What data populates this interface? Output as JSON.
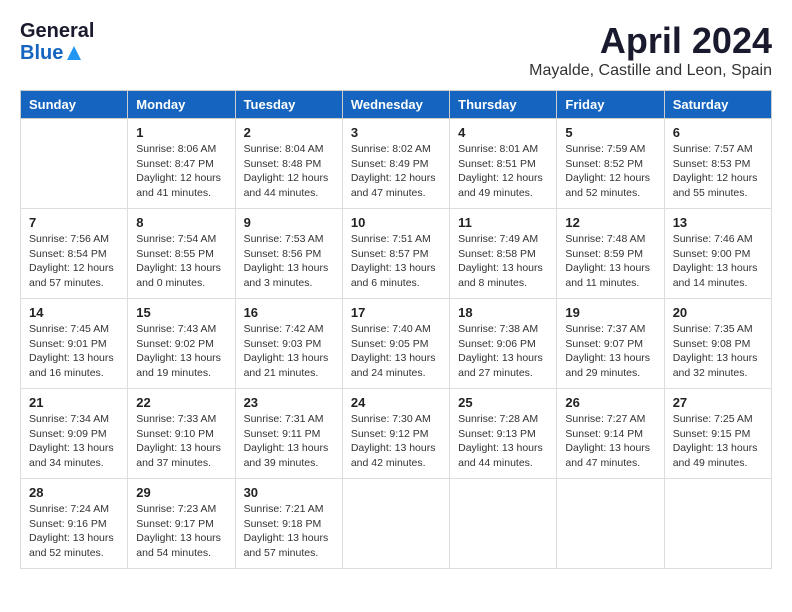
{
  "header": {
    "logo_general": "General",
    "logo_blue": "Blue",
    "month_title": "April 2024",
    "location": "Mayalde, Castille and Leon, Spain"
  },
  "columns": [
    "Sunday",
    "Monday",
    "Tuesday",
    "Wednesday",
    "Thursday",
    "Friday",
    "Saturday"
  ],
  "weeks": [
    [
      {
        "day": "",
        "lines": []
      },
      {
        "day": "1",
        "lines": [
          "Sunrise: 8:06 AM",
          "Sunset: 8:47 PM",
          "Daylight: 12 hours",
          "and 41 minutes."
        ]
      },
      {
        "day": "2",
        "lines": [
          "Sunrise: 8:04 AM",
          "Sunset: 8:48 PM",
          "Daylight: 12 hours",
          "and 44 minutes."
        ]
      },
      {
        "day": "3",
        "lines": [
          "Sunrise: 8:02 AM",
          "Sunset: 8:49 PM",
          "Daylight: 12 hours",
          "and 47 minutes."
        ]
      },
      {
        "day": "4",
        "lines": [
          "Sunrise: 8:01 AM",
          "Sunset: 8:51 PM",
          "Daylight: 12 hours",
          "and 49 minutes."
        ]
      },
      {
        "day": "5",
        "lines": [
          "Sunrise: 7:59 AM",
          "Sunset: 8:52 PM",
          "Daylight: 12 hours",
          "and 52 minutes."
        ]
      },
      {
        "day": "6",
        "lines": [
          "Sunrise: 7:57 AM",
          "Sunset: 8:53 PM",
          "Daylight: 12 hours",
          "and 55 minutes."
        ]
      }
    ],
    [
      {
        "day": "7",
        "lines": [
          "Sunrise: 7:56 AM",
          "Sunset: 8:54 PM",
          "Daylight: 12 hours",
          "and 57 minutes."
        ]
      },
      {
        "day": "8",
        "lines": [
          "Sunrise: 7:54 AM",
          "Sunset: 8:55 PM",
          "Daylight: 13 hours",
          "and 0 minutes."
        ]
      },
      {
        "day": "9",
        "lines": [
          "Sunrise: 7:53 AM",
          "Sunset: 8:56 PM",
          "Daylight: 13 hours",
          "and 3 minutes."
        ]
      },
      {
        "day": "10",
        "lines": [
          "Sunrise: 7:51 AM",
          "Sunset: 8:57 PM",
          "Daylight: 13 hours",
          "and 6 minutes."
        ]
      },
      {
        "day": "11",
        "lines": [
          "Sunrise: 7:49 AM",
          "Sunset: 8:58 PM",
          "Daylight: 13 hours",
          "and 8 minutes."
        ]
      },
      {
        "day": "12",
        "lines": [
          "Sunrise: 7:48 AM",
          "Sunset: 8:59 PM",
          "Daylight: 13 hours",
          "and 11 minutes."
        ]
      },
      {
        "day": "13",
        "lines": [
          "Sunrise: 7:46 AM",
          "Sunset: 9:00 PM",
          "Daylight: 13 hours",
          "and 14 minutes."
        ]
      }
    ],
    [
      {
        "day": "14",
        "lines": [
          "Sunrise: 7:45 AM",
          "Sunset: 9:01 PM",
          "Daylight: 13 hours",
          "and 16 minutes."
        ]
      },
      {
        "day": "15",
        "lines": [
          "Sunrise: 7:43 AM",
          "Sunset: 9:02 PM",
          "Daylight: 13 hours",
          "and 19 minutes."
        ]
      },
      {
        "day": "16",
        "lines": [
          "Sunrise: 7:42 AM",
          "Sunset: 9:03 PM",
          "Daylight: 13 hours",
          "and 21 minutes."
        ]
      },
      {
        "day": "17",
        "lines": [
          "Sunrise: 7:40 AM",
          "Sunset: 9:05 PM",
          "Daylight: 13 hours",
          "and 24 minutes."
        ]
      },
      {
        "day": "18",
        "lines": [
          "Sunrise: 7:38 AM",
          "Sunset: 9:06 PM",
          "Daylight: 13 hours",
          "and 27 minutes."
        ]
      },
      {
        "day": "19",
        "lines": [
          "Sunrise: 7:37 AM",
          "Sunset: 9:07 PM",
          "Daylight: 13 hours",
          "and 29 minutes."
        ]
      },
      {
        "day": "20",
        "lines": [
          "Sunrise: 7:35 AM",
          "Sunset: 9:08 PM",
          "Daylight: 13 hours",
          "and 32 minutes."
        ]
      }
    ],
    [
      {
        "day": "21",
        "lines": [
          "Sunrise: 7:34 AM",
          "Sunset: 9:09 PM",
          "Daylight: 13 hours",
          "and 34 minutes."
        ]
      },
      {
        "day": "22",
        "lines": [
          "Sunrise: 7:33 AM",
          "Sunset: 9:10 PM",
          "Daylight: 13 hours",
          "and 37 minutes."
        ]
      },
      {
        "day": "23",
        "lines": [
          "Sunrise: 7:31 AM",
          "Sunset: 9:11 PM",
          "Daylight: 13 hours",
          "and 39 minutes."
        ]
      },
      {
        "day": "24",
        "lines": [
          "Sunrise: 7:30 AM",
          "Sunset: 9:12 PM",
          "Daylight: 13 hours",
          "and 42 minutes."
        ]
      },
      {
        "day": "25",
        "lines": [
          "Sunrise: 7:28 AM",
          "Sunset: 9:13 PM",
          "Daylight: 13 hours",
          "and 44 minutes."
        ]
      },
      {
        "day": "26",
        "lines": [
          "Sunrise: 7:27 AM",
          "Sunset: 9:14 PM",
          "Daylight: 13 hours",
          "and 47 minutes."
        ]
      },
      {
        "day": "27",
        "lines": [
          "Sunrise: 7:25 AM",
          "Sunset: 9:15 PM",
          "Daylight: 13 hours",
          "and 49 minutes."
        ]
      }
    ],
    [
      {
        "day": "28",
        "lines": [
          "Sunrise: 7:24 AM",
          "Sunset: 9:16 PM",
          "Daylight: 13 hours",
          "and 52 minutes."
        ]
      },
      {
        "day": "29",
        "lines": [
          "Sunrise: 7:23 AM",
          "Sunset: 9:17 PM",
          "Daylight: 13 hours",
          "and 54 minutes."
        ]
      },
      {
        "day": "30",
        "lines": [
          "Sunrise: 7:21 AM",
          "Sunset: 9:18 PM",
          "Daylight: 13 hours",
          "and 57 minutes."
        ]
      },
      {
        "day": "",
        "lines": []
      },
      {
        "day": "",
        "lines": []
      },
      {
        "day": "",
        "lines": []
      },
      {
        "day": "",
        "lines": []
      }
    ]
  ]
}
